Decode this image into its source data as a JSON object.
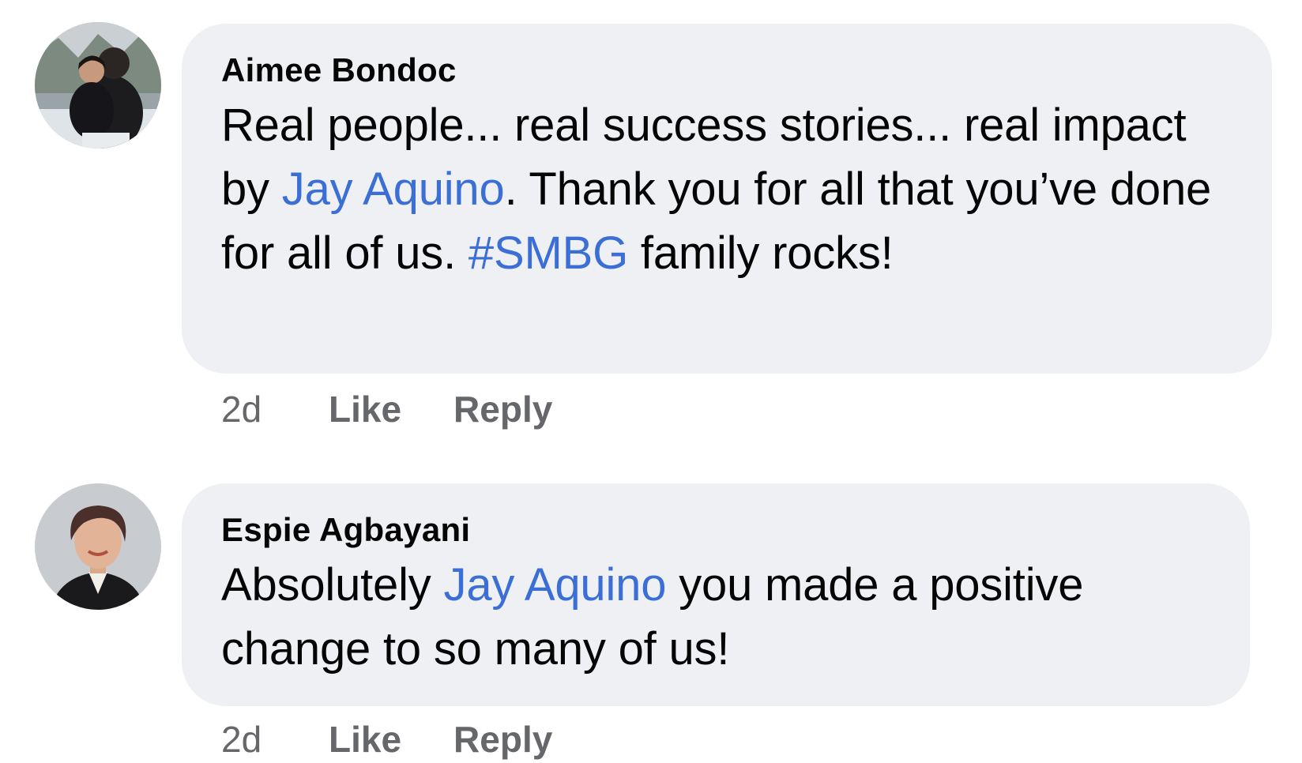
{
  "comments": [
    {
      "author": "Aimee Bondoc",
      "text_1": "Real people... real success stories... real impact by ",
      "mention": "Jay Aquino",
      "text_2": ". Thank you for all that you’ve done for all of us. ",
      "hashtag": "#SMBG",
      "text_3": " family rocks!",
      "time": "2d",
      "like_label": "Like",
      "reply_label": "Reply"
    },
    {
      "author": "Espie Agbayani",
      "text_1": "Absolutely ",
      "mention": "Jay Aquino",
      "text_2": " you made a positive change to so many of us!",
      "time": "2d",
      "like_label": "Like",
      "reply_label": "Reply"
    }
  ],
  "colors": {
    "bubble_bg": "#eff0f4",
    "link": "#3b6fd6",
    "meta_text": "#65676b",
    "main_text": "#050505"
  },
  "icons": [
    "profile-photo-avatar",
    "profile-photo-avatar"
  ]
}
